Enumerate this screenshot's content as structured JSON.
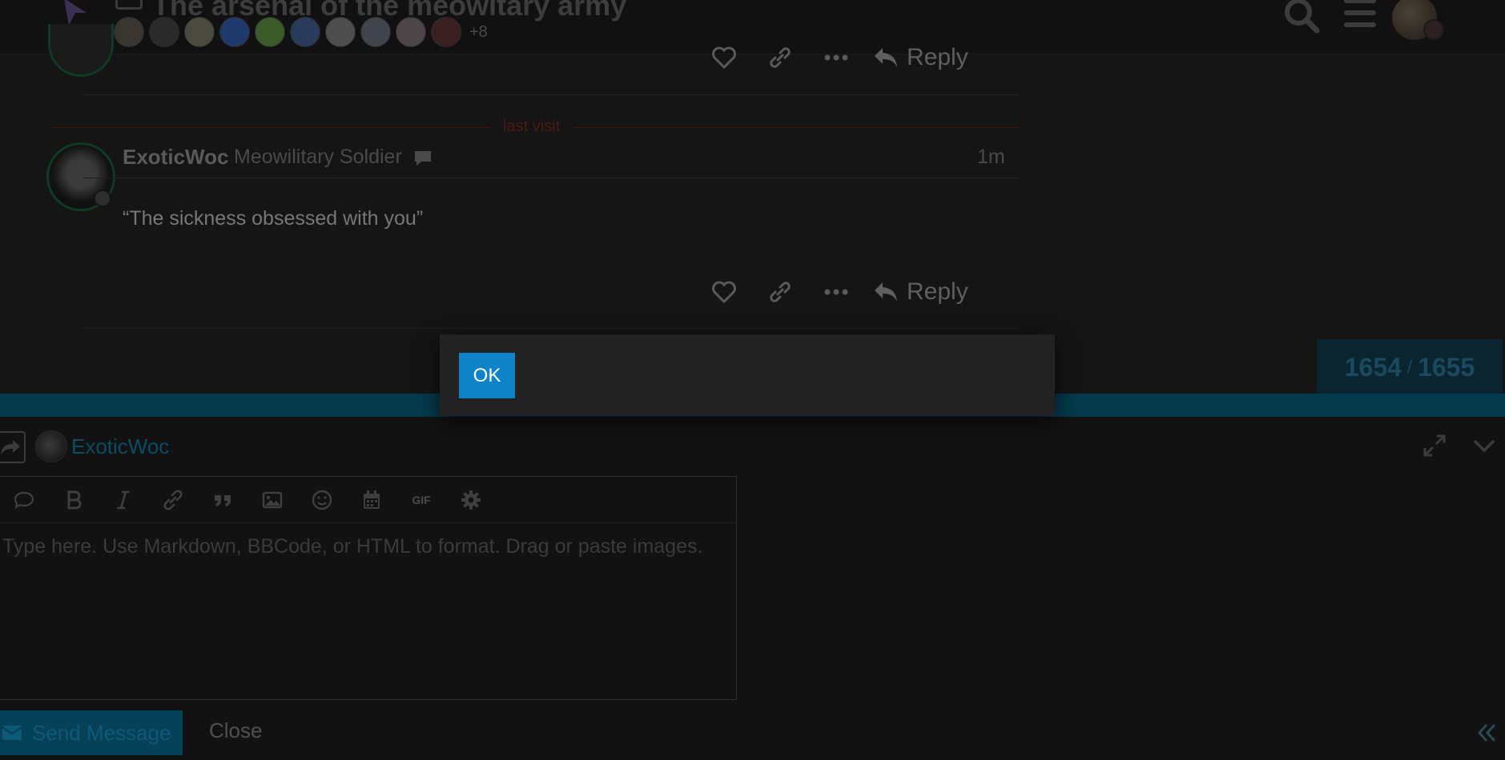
{
  "header": {
    "topic_title": "The arsenal of the meowitary army",
    "participants_more": "+8",
    "participant_avatars": [
      {
        "name": "participant-avatar-1",
        "color": "#3b3530"
      },
      {
        "name": "participant-avatar-2",
        "color": "#2a2a2a"
      },
      {
        "name": "participant-avatar-3",
        "color": "#4a4a3e"
      },
      {
        "name": "participant-avatar-4",
        "color": "#1f3a6a"
      },
      {
        "name": "participant-avatar-5",
        "color": "#3b5a2a"
      },
      {
        "name": "participant-avatar-6",
        "color": "#2a3a5a"
      },
      {
        "name": "participant-avatar-7",
        "color": "#4d4d4d"
      },
      {
        "name": "participant-avatar-8",
        "color": "#40454d"
      },
      {
        "name": "participant-avatar-9",
        "color": "#4d4548"
      },
      {
        "name": "participant-avatar-10",
        "color": "#3a2020"
      }
    ]
  },
  "posts": {
    "previous_reply_label": "Reply",
    "last_visit": "last visit",
    "current": {
      "username": "ExoticWoc",
      "user_title": "Meowilitary Soldier",
      "time": "1m",
      "body": "“The sickness obsessed with you”",
      "reply_label": "Reply"
    }
  },
  "progress": {
    "current": "1654",
    "separator": "/",
    "total": "1655"
  },
  "composer": {
    "recipient": "ExoticWoc",
    "placeholder": "Type here. Use Markdown, BBCode, or HTML to format. Drag or paste images.",
    "value": "",
    "gif_label": "GIF",
    "send_label": "Send Message",
    "close_label": "Close"
  },
  "modal": {
    "ok_label": "OK"
  },
  "colors": {
    "accent": "#0f83c8",
    "overlay_dim": "#151515",
    "last_visit_red": "#4b1a15"
  }
}
